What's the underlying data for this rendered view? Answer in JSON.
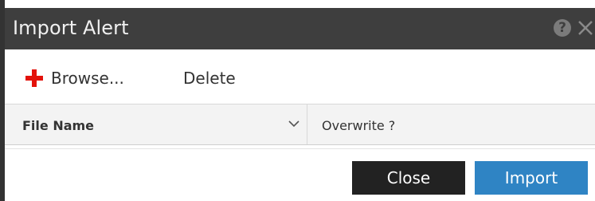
{
  "dialog": {
    "title": "Import Alert",
    "help_glyph": "?"
  },
  "toolbar": {
    "browse_label": "Browse...",
    "delete_label": "Delete"
  },
  "table": {
    "columns": [
      {
        "label": "File Name"
      },
      {
        "label": "Overwrite ?"
      }
    ]
  },
  "footer": {
    "close_label": "Close",
    "import_label": "Import"
  },
  "colors": {
    "titlebar": "#3e3e3e",
    "plus": "#e3120b",
    "close_button": "#222222",
    "import_button": "#2f84c4"
  }
}
